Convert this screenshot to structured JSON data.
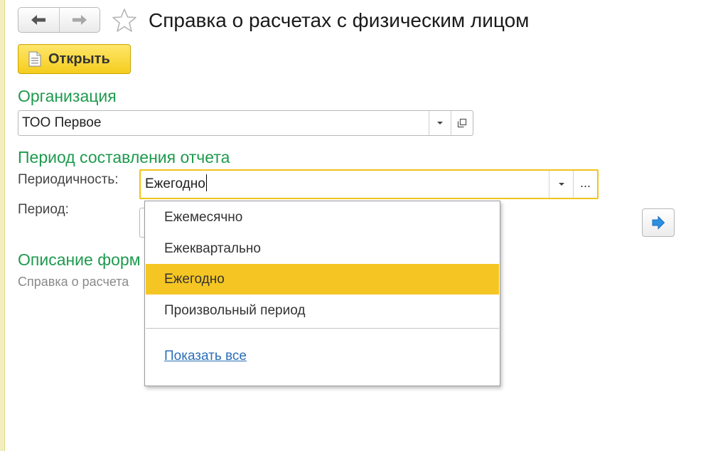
{
  "window": {
    "title": "Справка о расчетах с физическим лицом"
  },
  "toolbar": {
    "open_label": "Открыть"
  },
  "organization": {
    "section_label": "Организация",
    "value": "ТОО Первое"
  },
  "period_section": {
    "section_label": "Период составления отчета",
    "periodicity_label": "Периодичность:",
    "periodicity_value": "Ежегодно",
    "period_label": "Период:",
    "more_button_label": "..."
  },
  "description": {
    "section_label": "Описание форм",
    "text": "Справка о расчета"
  },
  "dropdown": {
    "options": [
      {
        "label": "Ежемесячно",
        "selected": false
      },
      {
        "label": "Ежеквартально",
        "selected": false
      },
      {
        "label": "Ежегодно",
        "selected": true
      },
      {
        "label": "Произвольный период",
        "selected": false
      }
    ],
    "show_all_label": "Показать все"
  },
  "colors": {
    "accent_yellow": "#f5c623",
    "section_green": "#1e9a4e",
    "link_blue": "#2a6eb8"
  },
  "icons": {
    "back": "arrow-left-icon",
    "forward": "arrow-right-icon",
    "favorite": "star-icon",
    "open": "document-icon",
    "dropdown": "chevron-down-icon",
    "open_form": "open-window-icon",
    "next": "arrow-right-blue-icon"
  }
}
